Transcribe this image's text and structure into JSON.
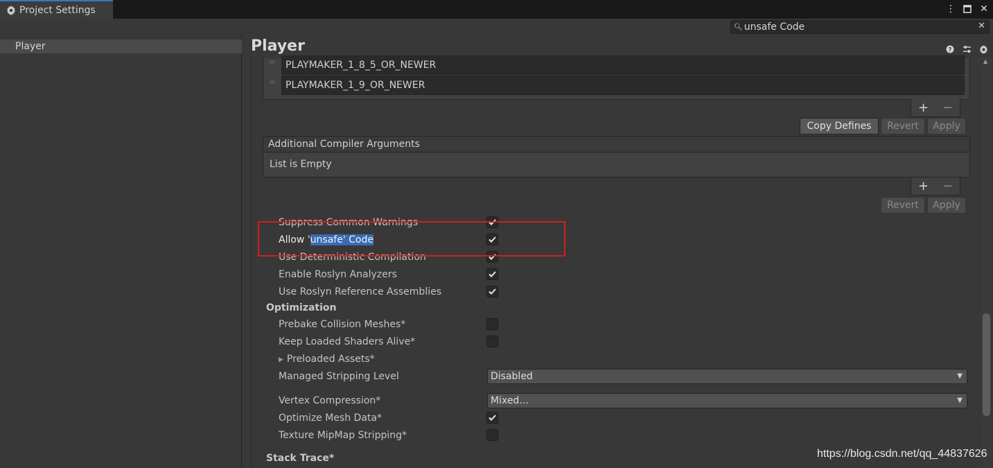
{
  "window": {
    "tab_title": "Project Settings",
    "icons": [
      "settings-gear-icon",
      "more-options-icon",
      "maximize-icon",
      "close-icon"
    ]
  },
  "search": {
    "value": "unsafe Code",
    "icon": "search-icon",
    "clear_icon": "clear-icon"
  },
  "sidebar": {
    "items": [
      {
        "label": "Player"
      }
    ]
  },
  "main": {
    "title": "Player",
    "header_icons": [
      "help-icon",
      "preset-icon",
      "settings-icon"
    ],
    "defines": [
      "PLAYMAKER_1_8_5_OR_NEWER",
      "PLAYMAKER_1_9_OR_NEWER"
    ],
    "plus": "+",
    "minus": "−",
    "copy_defines": "Copy Defines",
    "revert": "Revert",
    "apply": "Apply",
    "compiler_args": {
      "header": "Additional Compiler Arguments",
      "empty": "List is Empty"
    },
    "properties": {
      "suppress_warnings": {
        "label": "Suppress Common Warnings",
        "checked": true
      },
      "allow_unsafe": {
        "label_prefix": "Allow '",
        "label_highlight": "unsafe' Code",
        "checked": true
      },
      "deterministic": {
        "label": "Use Deterministic Compilation",
        "checked": true
      },
      "roslyn_analyzers": {
        "label": "Enable Roslyn Analyzers",
        "checked": true
      },
      "roslyn_assemblies": {
        "label": "Use Roslyn Reference Assemblies",
        "checked": true
      }
    },
    "optimization": {
      "title": "Optimization",
      "prebake": {
        "label": "Prebake Collision Meshes*",
        "checked": false
      },
      "keep_shaders": {
        "label": "Keep Loaded Shaders Alive*",
        "checked": false
      },
      "preloaded_assets": "Preloaded Assets*",
      "stripping": {
        "label": "Managed Stripping Level",
        "value": "Disabled"
      },
      "vertex_compression": {
        "label": "Vertex Compression*",
        "value": "Mixed..."
      },
      "optimize_mesh": {
        "label": "Optimize Mesh Data*",
        "checked": true
      },
      "mipmap_stripping": {
        "label": "Texture MipMap Stripping*",
        "checked": false
      }
    },
    "stack_trace": "Stack Trace*"
  },
  "watermark": "https://blog.csdn.net/qq_44837626",
  "colors": {
    "background": "#383838",
    "accent_tab": "#3a79bb",
    "selection": "#3a6bb4",
    "annotation": "#d01f1f"
  }
}
